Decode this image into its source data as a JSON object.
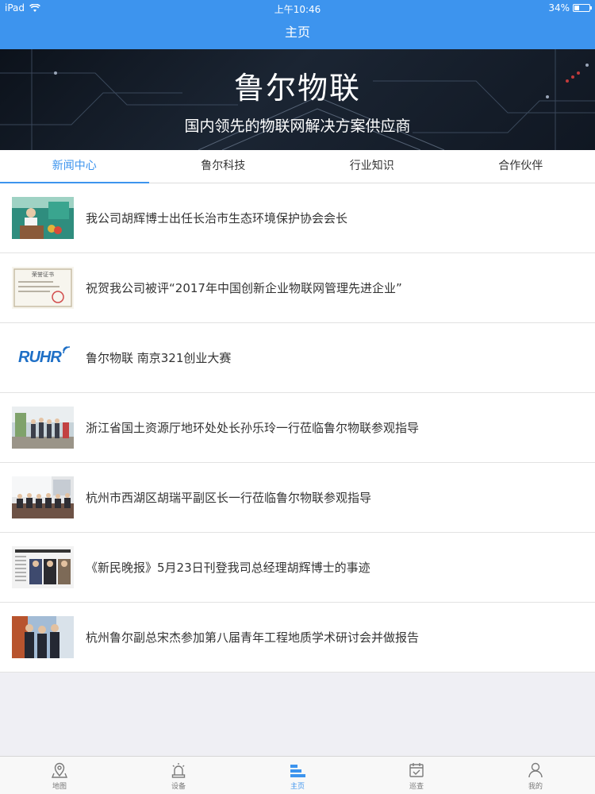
{
  "status_bar": {
    "device": "iPad",
    "time": "上午10:46",
    "battery": "34%",
    "battery_level": 0.34
  },
  "nav": {
    "title": "主页"
  },
  "banner": {
    "title": "鲁尔物联",
    "subtitle": "国内领先的物联网解决方案供应商"
  },
  "tabs": [
    {
      "label": "新闻中心",
      "active": true
    },
    {
      "label": "鲁尔科技",
      "active": false
    },
    {
      "label": "行业知识",
      "active": false
    },
    {
      "label": "合作伙伴",
      "active": false
    }
  ],
  "news": [
    {
      "title": "我公司胡辉博士出任长治市生态环境保护协会会长",
      "thumb_icon": "speech-photo-icon"
    },
    {
      "title": "祝贺我公司被评“2017年中国创新企业物联网管理先进企业”",
      "thumb_icon": "certificate-icon",
      "thumb_text": "荣誉证书"
    },
    {
      "title": "鲁尔物联 南京321创业大赛",
      "thumb_icon": "ruhr-logo",
      "thumb_text": "RUHR"
    },
    {
      "title": "浙江省国土资源厅地环处处长孙乐玲一行莅临鲁尔物联参观指导",
      "thumb_icon": "group-photo-icon"
    },
    {
      "title": "杭州市西湖区胡瑞平副区长一行莅临鲁尔物联参观指导",
      "thumb_icon": "meeting-photo-icon"
    },
    {
      "title": "《新民晚报》5月23日刊登我司总经理胡辉博士的事迹",
      "thumb_icon": "newspaper-icon"
    },
    {
      "title": "杭州鲁尔副总宋杰参加第八届青年工程地质学术研讨会并做报告",
      "thumb_icon": "people-photo-icon"
    }
  ],
  "tabbar": [
    {
      "label": "地图",
      "icon": "map-pin-icon",
      "active": false
    },
    {
      "label": "设备",
      "icon": "alarm-light-icon",
      "active": false
    },
    {
      "label": "主页",
      "icon": "home-bars-icon",
      "active": true
    },
    {
      "label": "巡查",
      "icon": "calendar-check-icon",
      "active": false
    },
    {
      "label": "我的",
      "icon": "user-icon",
      "active": false
    }
  ],
  "colors": {
    "accent": "#3d94ee",
    "background": "#efeff4",
    "text": "#333333"
  }
}
